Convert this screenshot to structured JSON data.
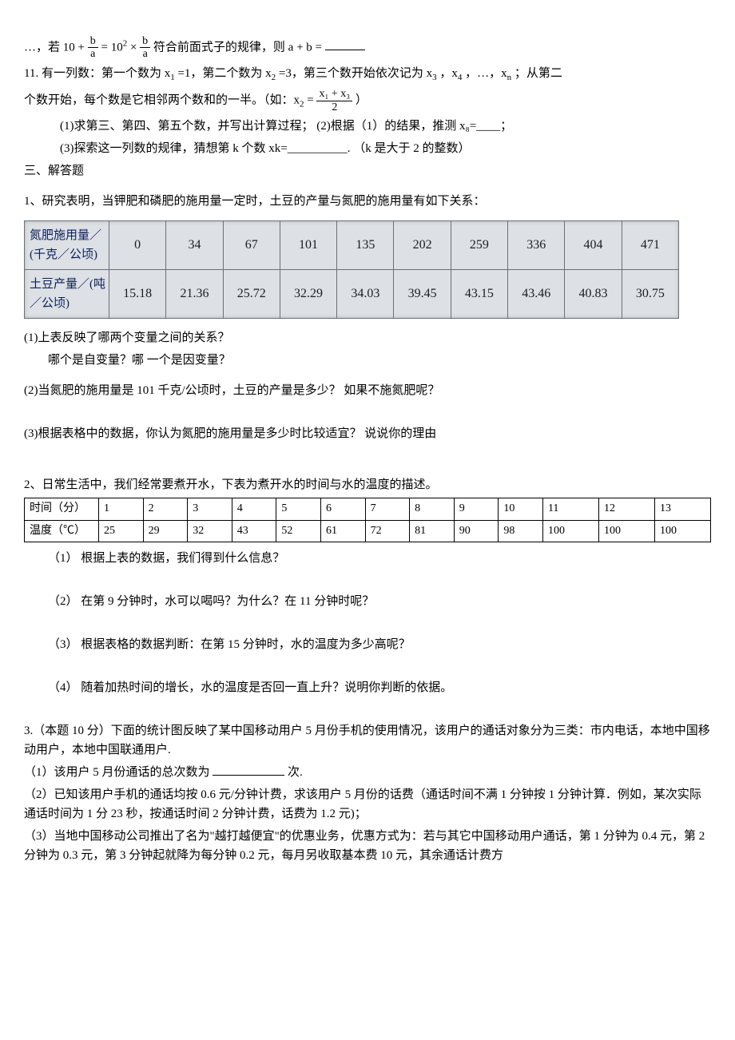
{
  "q10": {
    "line": "…，若",
    "eq_lhs_a": "10 +",
    "frac1_num": "b",
    "frac1_den": "a",
    "eq_mid": "= 10",
    "sup2": "2",
    "times": " ×",
    "frac2_num": "b",
    "frac2_den": "a",
    "tail": "符合前面式子的规律，则 a + b ="
  },
  "q11": {
    "p1a": "11. 有一列数：第一个数为 x",
    "p1b": "=1，第二个数为 x",
    "p1c": "=3，第三个数开始依次记为 x",
    "p1d": "，x",
    "p1e": "，…，x",
    "p1f": "；从第二",
    "p2a": "个数开始，每个数是它相邻两个数和的一半。（如：x",
    "p2b": "=",
    "frac_num": "x₁ + x₃",
    "frac_den": "2",
    "p2c": " ）",
    "s1": "(1)求第三、第四、第五个数，并写出计算过程；  (2)根据（1）的结果，推测 x₈=____；",
    "s2": "(3)探索这一列数的规律，猜想第 k 个数 xk=__________. （k 是大于 2 的整数）"
  },
  "sec3": "三、解答题",
  "p1": {
    "title": "1、研究表明，当钾肥和磷肥的施用量一定时，土豆的产量与氮肥的施用量有如下关系：",
    "row1_label": "氮肥施用量／(千克／公顷)",
    "row2_label": "土豆产量／(吨／公顷)",
    "row1": [
      "0",
      "34",
      "67",
      "101",
      "135",
      "202",
      "259",
      "336",
      "404",
      "471"
    ],
    "row2": [
      "15.18",
      "21.36",
      "25.72",
      "32.29",
      "34.03",
      "39.45",
      "43.15",
      "43.46",
      "40.83",
      "30.75"
    ],
    "q1a": "(1)上表反映了哪两个变量之间的关系？",
    "q1b": "哪个是自变量？哪 一个是因变量？",
    "q2": "(2)当氮肥的施用量是 101 千克/公顷时，土豆的产量是多少？  如果不施氮肥呢？",
    "q3": "(3)根据表格中的数据，你认为氮肥的施用量是多少时比较适宜？  说说你的理由"
  },
  "p2": {
    "title": "2、日常生活中，我们经常要煮开水，下表为煮开水的时间与水的温度的描述。",
    "r1lab": "时间（分）",
    "r2lab": "温度（℃）",
    "r1": [
      "1",
      "2",
      "3",
      "4",
      "5",
      "6",
      "7",
      "8",
      "9",
      "10",
      "11",
      "12",
      "13"
    ],
    "r2": [
      "25",
      "29",
      "32",
      "43",
      "52",
      "61",
      "72",
      "81",
      "90",
      "98",
      "100",
      "100",
      "100"
    ],
    "s1": "（1）  根据上表的数据，我们得到什么信息？",
    "s2": "（2）  在第 9 分钟时，水可以喝吗？为什么？在 11 分钟时呢？",
    "s3": "（3）  根据表格的数据判断：在第 15 分钟时，水的温度为多少高呢？",
    "s4": "（4）  随着加热时间的增长，水的温度是否回一直上升？说明你判断的依据。"
  },
  "p3": {
    "title": "3.（本题 10 分）下面的统计图反映了某中国移动用户 5 月份手机的使用情况，该用户的通话对象分为三类：市内电话，本地中国移动用户，本地中国联通用户.",
    "s1a": "（1）该用户 5 月份通话的总次数为",
    "s1b": "次.",
    "s2": "（2）已知该用户手机的通话均按 0.6 元/分钟计费，求该用户 5 月份的话费（通话时间不满 1 分钟按 1 分钟计算．例如，某次实际通话时间为 1 分 23 秒，按通话时间 2 分钟计费，话费为 1.2 元)；",
    "s3": "（3）当地中国移动公司推出了名为\"越打越便宜\"的优惠业务，优惠方式为：若与其它中国移动用户通话，第 1 分钟为 0.4 元，第 2 分钟为 0.3 元，第 3 分钟起就降为每分钟 0.2 元，每月另收取基本费 10 元，其余通话计费方"
  },
  "chart_data": [
    {
      "type": "table",
      "title": "氮肥施用量与土豆产量",
      "categories": [
        "氮肥施用量(千克/公顷)",
        "土豆产量(吨/公顷)"
      ],
      "series": [
        {
          "name": "氮肥施用量",
          "values": [
            0,
            34,
            67,
            101,
            135,
            202,
            259,
            336,
            404,
            471
          ]
        },
        {
          "name": "土豆产量",
          "values": [
            15.18,
            21.36,
            25.72,
            32.29,
            34.03,
            39.45,
            43.15,
            43.46,
            40.83,
            30.75
          ]
        }
      ]
    },
    {
      "type": "table",
      "title": "煮开水时间与温度",
      "categories": [
        "时间(分)",
        "温度(℃)"
      ],
      "series": [
        {
          "name": "时间",
          "values": [
            1,
            2,
            3,
            4,
            5,
            6,
            7,
            8,
            9,
            10,
            11,
            12,
            13
          ]
        },
        {
          "name": "温度",
          "values": [
            25,
            29,
            32,
            43,
            52,
            61,
            72,
            81,
            90,
            98,
            100,
            100,
            100
          ]
        }
      ]
    }
  ]
}
